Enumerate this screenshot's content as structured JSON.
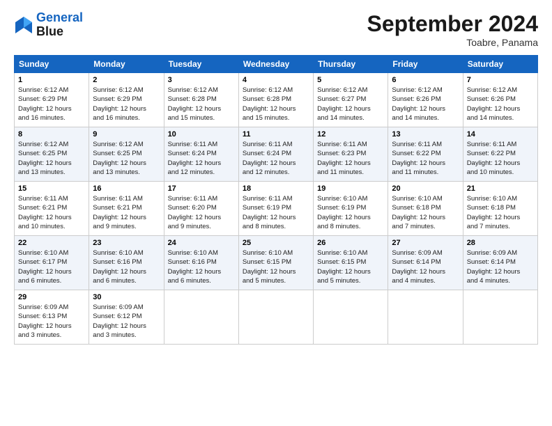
{
  "logo": {
    "line1": "General",
    "line2": "Blue"
  },
  "title": "September 2024",
  "location": "Toabre, Panama",
  "days_of_week": [
    "Sunday",
    "Monday",
    "Tuesday",
    "Wednesday",
    "Thursday",
    "Friday",
    "Saturday"
  ],
  "weeks": [
    [
      {
        "day": "1",
        "sunrise": "6:12 AM",
        "sunset": "6:29 PM",
        "daylight": "12 hours and 16 minutes."
      },
      {
        "day": "2",
        "sunrise": "6:12 AM",
        "sunset": "6:29 PM",
        "daylight": "12 hours and 16 minutes."
      },
      {
        "day": "3",
        "sunrise": "6:12 AM",
        "sunset": "6:28 PM",
        "daylight": "12 hours and 15 minutes."
      },
      {
        "day": "4",
        "sunrise": "6:12 AM",
        "sunset": "6:28 PM",
        "daylight": "12 hours and 15 minutes."
      },
      {
        "day": "5",
        "sunrise": "6:12 AM",
        "sunset": "6:27 PM",
        "daylight": "12 hours and 14 minutes."
      },
      {
        "day": "6",
        "sunrise": "6:12 AM",
        "sunset": "6:26 PM",
        "daylight": "12 hours and 14 minutes."
      },
      {
        "day": "7",
        "sunrise": "6:12 AM",
        "sunset": "6:26 PM",
        "daylight": "12 hours and 14 minutes."
      }
    ],
    [
      {
        "day": "8",
        "sunrise": "6:12 AM",
        "sunset": "6:25 PM",
        "daylight": "12 hours and 13 minutes."
      },
      {
        "day": "9",
        "sunrise": "6:12 AM",
        "sunset": "6:25 PM",
        "daylight": "12 hours and 13 minutes."
      },
      {
        "day": "10",
        "sunrise": "6:11 AM",
        "sunset": "6:24 PM",
        "daylight": "12 hours and 12 minutes."
      },
      {
        "day": "11",
        "sunrise": "6:11 AM",
        "sunset": "6:24 PM",
        "daylight": "12 hours and 12 minutes."
      },
      {
        "day": "12",
        "sunrise": "6:11 AM",
        "sunset": "6:23 PM",
        "daylight": "12 hours and 11 minutes."
      },
      {
        "day": "13",
        "sunrise": "6:11 AM",
        "sunset": "6:22 PM",
        "daylight": "12 hours and 11 minutes."
      },
      {
        "day": "14",
        "sunrise": "6:11 AM",
        "sunset": "6:22 PM",
        "daylight": "12 hours and 10 minutes."
      }
    ],
    [
      {
        "day": "15",
        "sunrise": "6:11 AM",
        "sunset": "6:21 PM",
        "daylight": "12 hours and 10 minutes."
      },
      {
        "day": "16",
        "sunrise": "6:11 AM",
        "sunset": "6:21 PM",
        "daylight": "12 hours and 9 minutes."
      },
      {
        "day": "17",
        "sunrise": "6:11 AM",
        "sunset": "6:20 PM",
        "daylight": "12 hours and 9 minutes."
      },
      {
        "day": "18",
        "sunrise": "6:11 AM",
        "sunset": "6:19 PM",
        "daylight": "12 hours and 8 minutes."
      },
      {
        "day": "19",
        "sunrise": "6:10 AM",
        "sunset": "6:19 PM",
        "daylight": "12 hours and 8 minutes."
      },
      {
        "day": "20",
        "sunrise": "6:10 AM",
        "sunset": "6:18 PM",
        "daylight": "12 hours and 7 minutes."
      },
      {
        "day": "21",
        "sunrise": "6:10 AM",
        "sunset": "6:18 PM",
        "daylight": "12 hours and 7 minutes."
      }
    ],
    [
      {
        "day": "22",
        "sunrise": "6:10 AM",
        "sunset": "6:17 PM",
        "daylight": "12 hours and 6 minutes."
      },
      {
        "day": "23",
        "sunrise": "6:10 AM",
        "sunset": "6:16 PM",
        "daylight": "12 hours and 6 minutes."
      },
      {
        "day": "24",
        "sunrise": "6:10 AM",
        "sunset": "6:16 PM",
        "daylight": "12 hours and 6 minutes."
      },
      {
        "day": "25",
        "sunrise": "6:10 AM",
        "sunset": "6:15 PM",
        "daylight": "12 hours and 5 minutes."
      },
      {
        "day": "26",
        "sunrise": "6:10 AM",
        "sunset": "6:15 PM",
        "daylight": "12 hours and 5 minutes."
      },
      {
        "day": "27",
        "sunrise": "6:09 AM",
        "sunset": "6:14 PM",
        "daylight": "12 hours and 4 minutes."
      },
      {
        "day": "28",
        "sunrise": "6:09 AM",
        "sunset": "6:14 PM",
        "daylight": "12 hours and 4 minutes."
      }
    ],
    [
      {
        "day": "29",
        "sunrise": "6:09 AM",
        "sunset": "6:13 PM",
        "daylight": "12 hours and 3 minutes."
      },
      {
        "day": "30",
        "sunrise": "6:09 AM",
        "sunset": "6:12 PM",
        "daylight": "12 hours and 3 minutes."
      },
      null,
      null,
      null,
      null,
      null
    ]
  ]
}
